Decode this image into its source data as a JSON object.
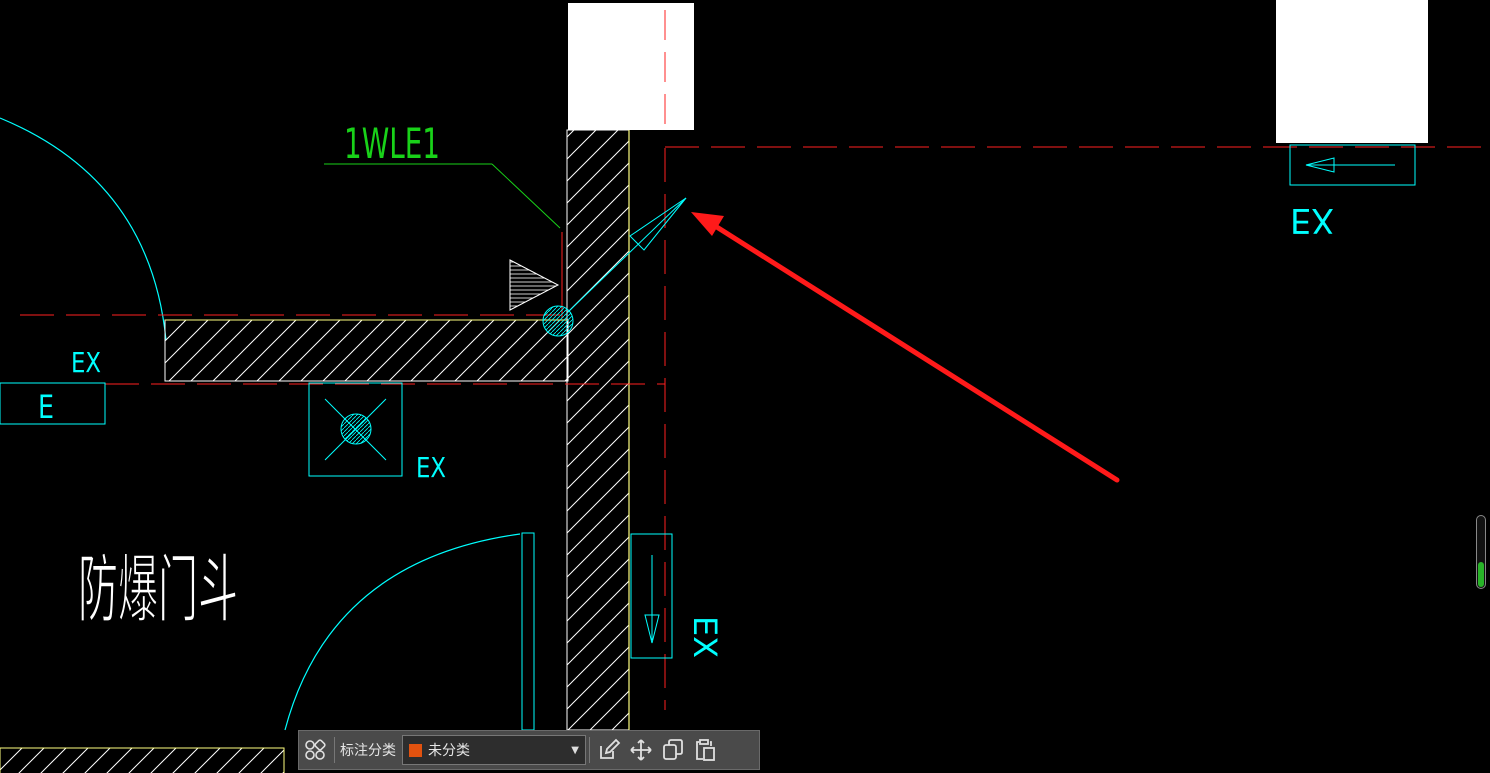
{
  "drawing": {
    "circuit_label": "1WLE1",
    "room_name": "防爆门斗",
    "fixture_labels": [
      "EX",
      "E",
      "EX",
      "EX",
      "EX"
    ]
  },
  "toolbar": {
    "category_label": "标注分类",
    "category_value": "未分类",
    "category_color": "#e2520f"
  },
  "zoom": {
    "level": 0.35
  },
  "colors": {
    "cyan": "#00ffff",
    "yellow": "#ffff80",
    "red": "#ff2020",
    "green": "#19d219",
    "annotation_arrow": "#ff1a1a"
  }
}
